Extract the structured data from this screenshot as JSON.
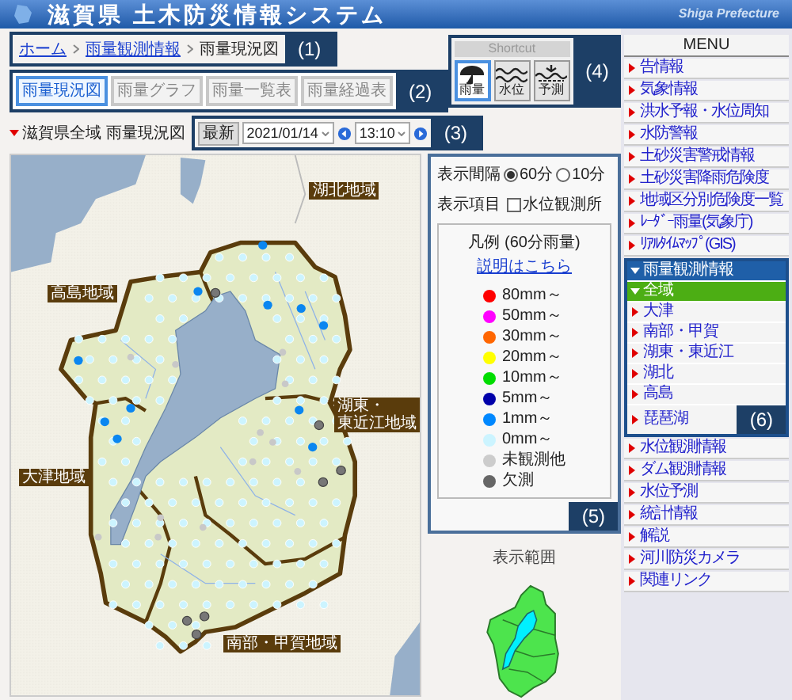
{
  "header": {
    "title": "滋賀県 土木防災情報システム",
    "brand": "Shiga Prefecture"
  },
  "breadcrumb": [
    {
      "label": "ホーム",
      "link": true
    },
    {
      "label": "雨量観測情報",
      "link": true
    },
    {
      "label": "雨量現況図",
      "link": false
    }
  ],
  "tabs": [
    {
      "label": "雨量現況図",
      "selected": true
    },
    {
      "label": "雨量グラフ",
      "selected": false
    },
    {
      "label": "雨量一覧表",
      "selected": false
    },
    {
      "label": "雨量経過表",
      "selected": false
    }
  ],
  "map_title": "滋賀県全域 雨量現況図",
  "controls": {
    "latest_button": "最新",
    "date": "2021/01/14",
    "time": "13:10"
  },
  "shortcut": {
    "title": "Shortcut",
    "buttons": [
      {
        "label": "雨量",
        "kind": "rain",
        "selected": true
      },
      {
        "label": "水位",
        "kind": "water",
        "selected": false
      },
      {
        "label": "予測",
        "kind": "forecast",
        "selected": false
      }
    ]
  },
  "display": {
    "interval_label": "表示間隔",
    "options": [
      {
        "label": "60分",
        "selected": true
      },
      {
        "label": "10分",
        "selected": false
      }
    ],
    "items_label": "表示項目",
    "checkbox": {
      "label": "水位観測所",
      "checked": false
    }
  },
  "legend": {
    "title": "凡例 (60分雨量)",
    "link": "説明はこちら",
    "items": [
      {
        "label": "80mm～",
        "color": "#ff0000"
      },
      {
        "label": "50mm～",
        "color": "#ff00ff"
      },
      {
        "label": "30mm～",
        "color": "#ff6600"
      },
      {
        "label": "20mm～",
        "color": "#ffff00"
      },
      {
        "label": "10mm～",
        "color": "#00dd00"
      },
      {
        "label": "5mm～",
        "color": "#0000aa"
      },
      {
        "label": "1mm～",
        "color": "#0088ff"
      },
      {
        "label": "0mm～",
        "color": "#ccf4ff"
      },
      {
        "label": "未観測他",
        "color": "#cccccc"
      },
      {
        "label": "欠測",
        "color": "#666666"
      }
    ]
  },
  "range_label": "表示範囲",
  "map_labels": [
    {
      "lines": [
        "湖北地域"
      ]
    },
    {
      "lines": [
        "高島地域"
      ]
    },
    {
      "lines": [
        "湖東・",
        "東近江地域"
      ]
    },
    {
      "lines": [
        "大津地域"
      ]
    },
    {
      "lines": [
        "南部・甲賀地域"
      ]
    }
  ],
  "menu": {
    "title": "MENU",
    "items": [
      {
        "label": "告情報",
        "selected": false
      },
      {
        "label": "気象情報",
        "selected": false
      },
      {
        "label": "洪水予報・水位周知",
        "selected": false
      },
      {
        "label": "水防警報",
        "selected": false
      },
      {
        "label": "土砂災害警戒情報",
        "selected": false
      },
      {
        "label": "土砂災害降雨危険度",
        "selected": false
      },
      {
        "label": "地域区分別危険度一覧",
        "selected": false
      },
      {
        "label": "ﾚｰﾀﾞｰ雨量(気象庁)",
        "selected": false
      },
      {
        "label": "ﾘｱﾙﾀｲﾑﾏｯﾌﾟ(GIS)",
        "selected": false
      },
      {
        "label": "雨量観測情報",
        "selected": false,
        "expanded": true,
        "children": [
          {
            "label": "全域",
            "selected": true
          },
          {
            "label": "大津",
            "selected": false
          },
          {
            "label": "南部・甲賀",
            "selected": false
          },
          {
            "label": "湖東・東近江",
            "selected": false
          },
          {
            "label": "湖北",
            "selected": false
          },
          {
            "label": "高島",
            "selected": false
          },
          {
            "label": "琵琶湖",
            "selected": false
          }
        ]
      },
      {
        "label": "水位観測情報",
        "selected": false
      },
      {
        "label": "ダム観測情報",
        "selected": false
      },
      {
        "label": "水位予測",
        "selected": false
      },
      {
        "label": "統計情報",
        "selected": false
      },
      {
        "label": "解説",
        "selected": false
      },
      {
        "label": "河川防災カメラ",
        "selected": false
      },
      {
        "label": "関連リンク",
        "selected": false
      }
    ]
  },
  "callouts": [
    "(1)",
    "(2)",
    "(3)",
    "(4)",
    "(5)",
    "(6)"
  ]
}
